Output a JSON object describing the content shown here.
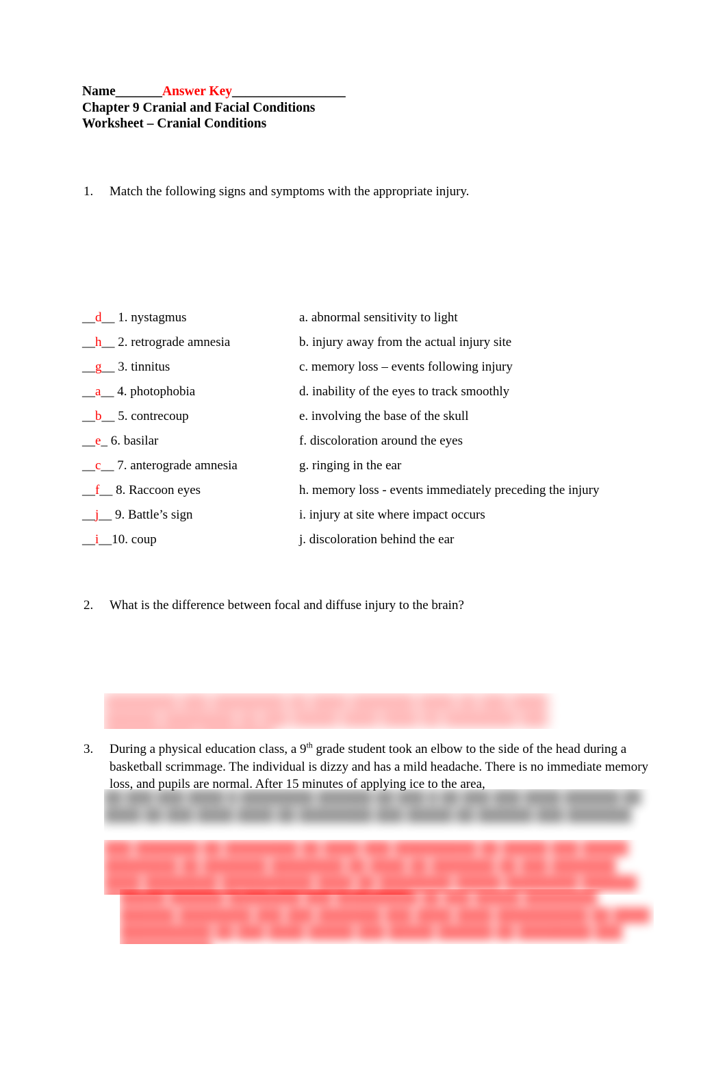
{
  "document": {
    "header": {
      "name_label": "Name",
      "blank_before": "_______",
      "answer_key": "Answer Key",
      "blank_after": "_________________",
      "chapter_line": "Chapter 9  Cranial and Facial Conditions",
      "worksheet_line": "Worksheet – Cranial Conditions"
    },
    "questions": [
      {
        "number": "1.",
        "text": "Match the following signs and symptoms with the appropriate injury."
      },
      {
        "number": "2.",
        "text": "What is the difference between focal and diffuse injury to the brain?"
      },
      {
        "number": "3.",
        "text_part1": "During a physical education class, a 9",
        "superscript": "th",
        "text_part2": " grade student took an elbow to the side of the head during a basketball scrimmage. The individual is dizzy and has a mild headache. There is no immediate memory loss, and pupils are normal. After 15 minutes of applying ice to the area,"
      }
    ],
    "matching": {
      "items": [
        {
          "blank_pre": "__",
          "answer": "d",
          "blank_post": "__ ",
          "number": "1.",
          "term": "nystagmus"
        },
        {
          "blank_pre": "__",
          "answer": "h",
          "blank_post": "__ ",
          "number": "2.",
          "term": "retrograde amnesia"
        },
        {
          "blank_pre": "__",
          "answer": "g",
          "blank_post": "__ ",
          "number": "3.",
          "term": "tinnitus"
        },
        {
          "blank_pre": "__",
          "answer": "a",
          "blank_post": "__ ",
          "number": "4.",
          "term": "photophobia"
        },
        {
          "blank_pre": "__",
          "answer": "b",
          "blank_post": "__ ",
          "number": "5.",
          "term": "contrecoup"
        },
        {
          "blank_pre": "__",
          "answer": "e",
          "blank_post": "_  ",
          "number": "6.",
          "term": "basilar"
        },
        {
          "blank_pre": "__",
          "answer": "c",
          "blank_post": "__ ",
          "number": "7.",
          "term": "anterograde amnesia"
        },
        {
          "blank_pre": "__",
          "answer": "f",
          "blank_post": "__ ",
          "number": "8.",
          "term": "Raccoon eyes"
        },
        {
          "blank_pre": "__",
          "answer": "j",
          "blank_post": "__ ",
          "number": "9.",
          "term": "Battle’s sign"
        },
        {
          "blank_pre": "__",
          "answer": "i",
          "blank_post": "__",
          "number": "10.",
          "term": " coup"
        }
      ],
      "definitions": [
        "a. abnormal sensitivity to light",
        "b. injury away from the actual injury site",
        "c. memory loss – events following injury",
        "d. inability of the eyes to track smoothly",
        "e. involving the base of the skull",
        "f. discoloration around the eyes",
        "g. ringing in the ear",
        "h. memory loss - events immediately preceding the injury",
        "i. injury at site where impact occurs",
        "j. discoloration behind the ear"
      ]
    },
    "obscured": {
      "q2_answer": "████████ ███ ████████ ██ ████ ███████ ████ ██ ███ ████ ██████ ████████ ██ ███ █████ ████ ████ ██ ████████ ███ ██████████ ████████",
      "q3_continuation": "██ ███ ███ ████ █ ████████ ██████ ██ ███ █ ██ ███ ███ ████ ██████ ██ ████ ██ ███ ████ ████ ██ ████████ ███ █████ ██ ██████ ███ ███████",
      "q3_answer": "███ ███████ ██ ████████ ██ ████ ███ █████████ ██ █████ ███ █████ ████████ ██ ███████ ████████ ██ ████ ██ ███████ ██ ███ ███████ ████ ████████ ██████████ ████ ██ ████████ █████ ████████ ██████ ████ ████████ ██ ███ ████████ ██ ████",
      "q3_answer2": "█████ ██████ ████████ ███ █████████ ██ ███ █████ ████████ ██████ ████████ ███ ███ ███████ ███ ████ ████ ██████████ ██ ████ ██████████ ██ ███ ████ █████ ███ █████ ██████ ██ ████████ ███ ██████████"
    },
    "colors": {
      "answer_red": "#ff0000",
      "text_black": "#000000",
      "page_background": "#ffffff"
    }
  }
}
